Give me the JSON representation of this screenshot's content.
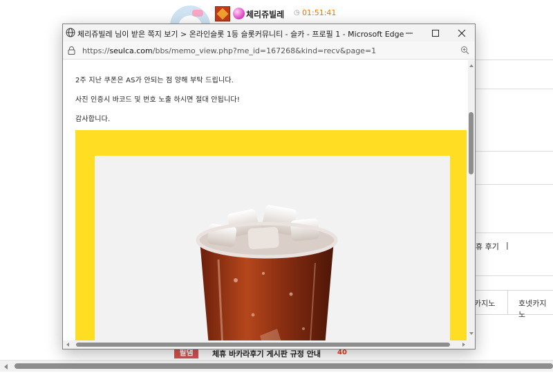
{
  "background_page": {
    "nickname": "체리쥬빌레",
    "time": "01:51:41",
    "right_text_1": "휴 후기",
    "right_text_2": "|",
    "tab_1": "카지노",
    "tab_2": "호넷카지노",
    "bottom_badge": "필댐",
    "bottom_title": "체휴 바카라후기 게시판 규정 안내",
    "bottom_count": "40"
  },
  "window": {
    "title": "체리쥬빌레 님이 받은 쪽지 보기 > 온라인슬롯 1등 슬롯커뮤니티 - 슬카 - 프로필 1 - Microsoft Edge",
    "url_prefix": "https://",
    "url_domain": "seulca.com",
    "url_path": "/bbs/memo_view.php?me_id=167268&kind=recv&page=1",
    "controls": {
      "minimize": "minimize-icon",
      "maximize": "maximize-icon",
      "close": "close-icon"
    }
  },
  "message": {
    "line_1": "2주 지난 쿠폰은 AS가 안되는 점 양해 부탁 드립니다.",
    "line_2": "사진 인증시 바코드 및 번호 노출 하시면 절대 안됩니다!",
    "line_3": "감사합니다."
  },
  "colors": {
    "coupon_background": "#fedd22",
    "accent_time": "#e07b10",
    "badge_red": "#d9534f"
  }
}
